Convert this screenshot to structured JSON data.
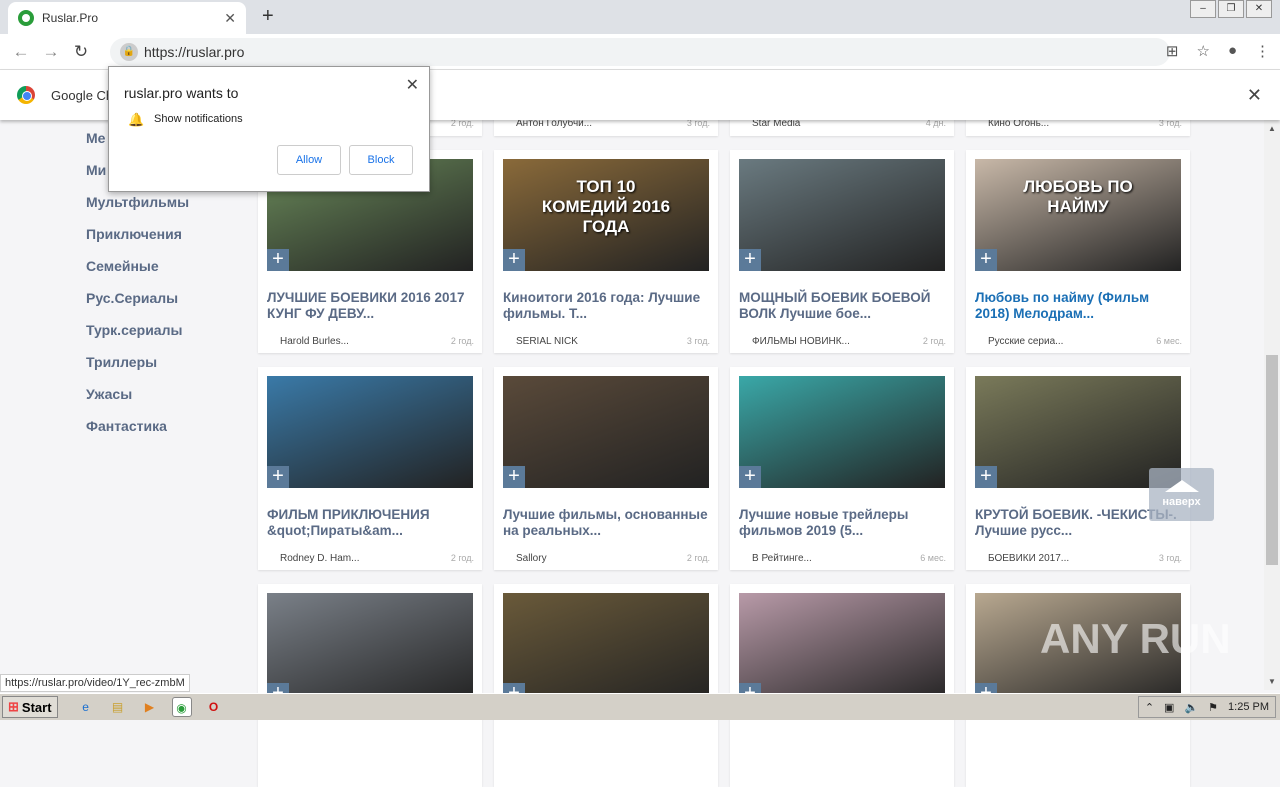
{
  "browser": {
    "tab_title": "Ruslar.Pro",
    "url": "https://ruslar.pro",
    "status_url": "https://ruslar.pro/video/1Y_rec-zmbM"
  },
  "infobar": {
    "text": "Google Ch"
  },
  "popup": {
    "title": "ruslar.pro wants to",
    "permission": "Show notifications",
    "allow": "Allow",
    "block": "Block"
  },
  "sidebar": [
    "Ме",
    "Ми",
    "Мультфильмы",
    "Приключения",
    "Семейные",
    "Рус.Сериалы",
    "Турк.сериалы",
    "Триллеры",
    "Ужасы",
    "Фантастика"
  ],
  "top_row": [
    {
      "author": "",
      "age": "2 год."
    },
    {
      "author": "Антон Голубчи...",
      "age": "3 год."
    },
    {
      "author": "Star Media",
      "age": "4 дн."
    },
    {
      "author": "Кино Огонь...",
      "age": "3 год."
    }
  ],
  "cards": [
    {
      "title": "ЛУЧШИЕ БОЕВИКИ 2016 2017 КУНГ ФУ ДЕВУ...",
      "author": "Harold Burles...",
      "age": "2 год.",
      "color": "#6a8a5a",
      "overlay": ""
    },
    {
      "title": "Киноитоги 2016 года: Лучшие фильмы. Т...",
      "author": "SERIAL NICK",
      "age": "3 год.",
      "color": "#8a6a3a",
      "overlay": "ТОП 10 КОМЕДИЙ 2016 ГОДА"
    },
    {
      "title": "МОЩНЫЙ БОЕВИК БОЕВОЙ ВОЛК Лучшие бое...",
      "author": "ФИЛЬМЫ НОВИНК...",
      "age": "2 год.",
      "color": "#6a7a80",
      "overlay": ""
    },
    {
      "title": "Любовь по найму (Фильм 2018) Мелодрам...",
      "author": "Русские сериа...",
      "age": "6 мес.",
      "color": "#c8b8a8",
      "overlay": "ЛЮБОВЬ ПО НАЙМУ"
    },
    {
      "title": "ФИЛЬМ ПРИКЛЮЧЕНИЯ &quot;Пираты&am...",
      "author": "Rodney D. Ham...",
      "age": "2 год.",
      "color": "#3a7aa8",
      "overlay": ""
    },
    {
      "title": "Лучшие фильмы, основанные на реальных...",
      "author": "Sallory",
      "age": "2 год.",
      "color": "#5a4a3a",
      "overlay": ""
    },
    {
      "title": "Лучшие новые трейлеры фильмов 2019 (5...",
      "author": "В Рейтинге...",
      "age": "6 мес.",
      "color": "#3aa8a8",
      "overlay": ""
    },
    {
      "title": "КРУТОЙ БОЕВИК. -ЧЕКИСТЫ-. Лучшие русс...",
      "author": "БОЕВИКИ 2017...",
      "age": "3 год.",
      "color": "#7a7a5a",
      "overlay": ""
    },
    {
      "title": "",
      "author": "",
      "age": "",
      "color": "#7a8088",
      "overlay": ""
    },
    {
      "title": "",
      "author": "",
      "age": "",
      "color": "#6a5a3a",
      "overlay": ""
    },
    {
      "title": "",
      "author": "",
      "age": "",
      "color": "#b89aa8",
      "overlay": ""
    },
    {
      "title": "",
      "author": "",
      "age": "",
      "color": "#b8a890",
      "overlay": ""
    }
  ],
  "to_top": "наверх",
  "watermark": "ANY RUN",
  "taskbar": {
    "start": "Start",
    "time": "1:25 PM"
  }
}
